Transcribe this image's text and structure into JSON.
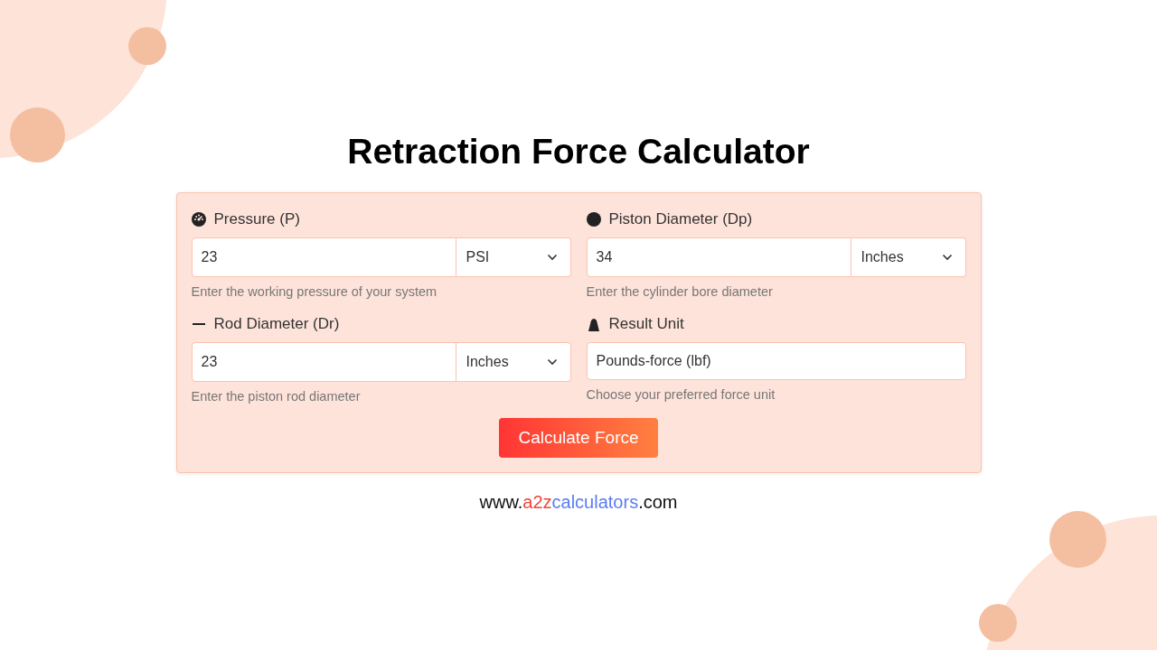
{
  "title": "Retraction Force Calculator",
  "fields": [
    {
      "label": "Pressure (P)",
      "kind": "with_unit",
      "value": "23",
      "unit": "PSI",
      "hint": "Enter the working pressure of your system"
    },
    {
      "label": "Piston Diameter (Dp)",
      "kind": "with_unit",
      "value": "34",
      "unit": "Inches",
      "hint": "Enter the cylinder bore diameter"
    },
    {
      "label": "Rod Diameter (Dr)",
      "kind": "with_unit",
      "value": "23",
      "unit": "Inches",
      "hint": "Enter the piston rod diameter"
    },
    {
      "label": "Result Unit",
      "kind": "plain",
      "value": "Pounds-force (lbf)",
      "hint": "Choose your preferred force unit"
    }
  ],
  "button": "Calculate Force",
  "website": [
    {
      "text": "www.",
      "color": "#111111"
    },
    {
      "text": "a2z",
      "color": "#f0443a"
    },
    {
      "text": "calculators",
      "color": "#5b7cf0"
    },
    {
      "text": ".com",
      "color": "#111111"
    }
  ]
}
